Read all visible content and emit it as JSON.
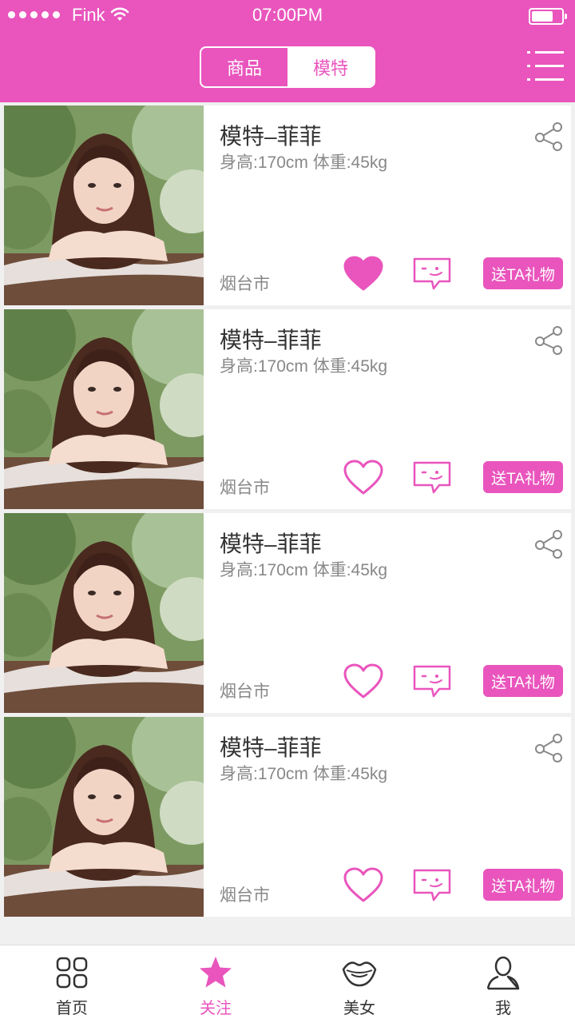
{
  "status_bar": {
    "carrier": "Fink",
    "time": "07:00PM"
  },
  "header": {
    "segments": [
      {
        "label": "商品",
        "active": false
      },
      {
        "label": "模特",
        "active": true
      }
    ],
    "menu_icon": "list-menu-icon"
  },
  "models": [
    {
      "name": "模特–菲菲",
      "stats": "身高:170cm   体重:45kg",
      "city": "烟台市",
      "liked": true,
      "gift_label": "送TA礼物"
    },
    {
      "name": "模特–菲菲",
      "stats": "身高:170cm   体重:45kg",
      "city": "烟台市",
      "liked": false,
      "gift_label": "送TA礼物"
    },
    {
      "name": "模特–菲菲",
      "stats": "身高:170cm   体重:45kg",
      "city": "烟台市",
      "liked": false,
      "gift_label": "送TA礼物"
    },
    {
      "name": "模特–菲菲",
      "stats": "身高:170cm   体重:45kg",
      "city": "烟台市",
      "liked": false,
      "gift_label": "送TA礼物"
    }
  ],
  "tabbar": {
    "tabs": [
      {
        "label": "首页",
        "icon": "grid-icon",
        "active": false
      },
      {
        "label": "关注",
        "icon": "star-icon",
        "active": true
      },
      {
        "label": "美女",
        "icon": "lips-icon",
        "active": false
      },
      {
        "label": "我",
        "icon": "person-icon",
        "active": false
      }
    ]
  },
  "colors": {
    "accent": "#e955bd",
    "background": "#f0f0f0",
    "text": "#333333",
    "muted": "#888888"
  }
}
